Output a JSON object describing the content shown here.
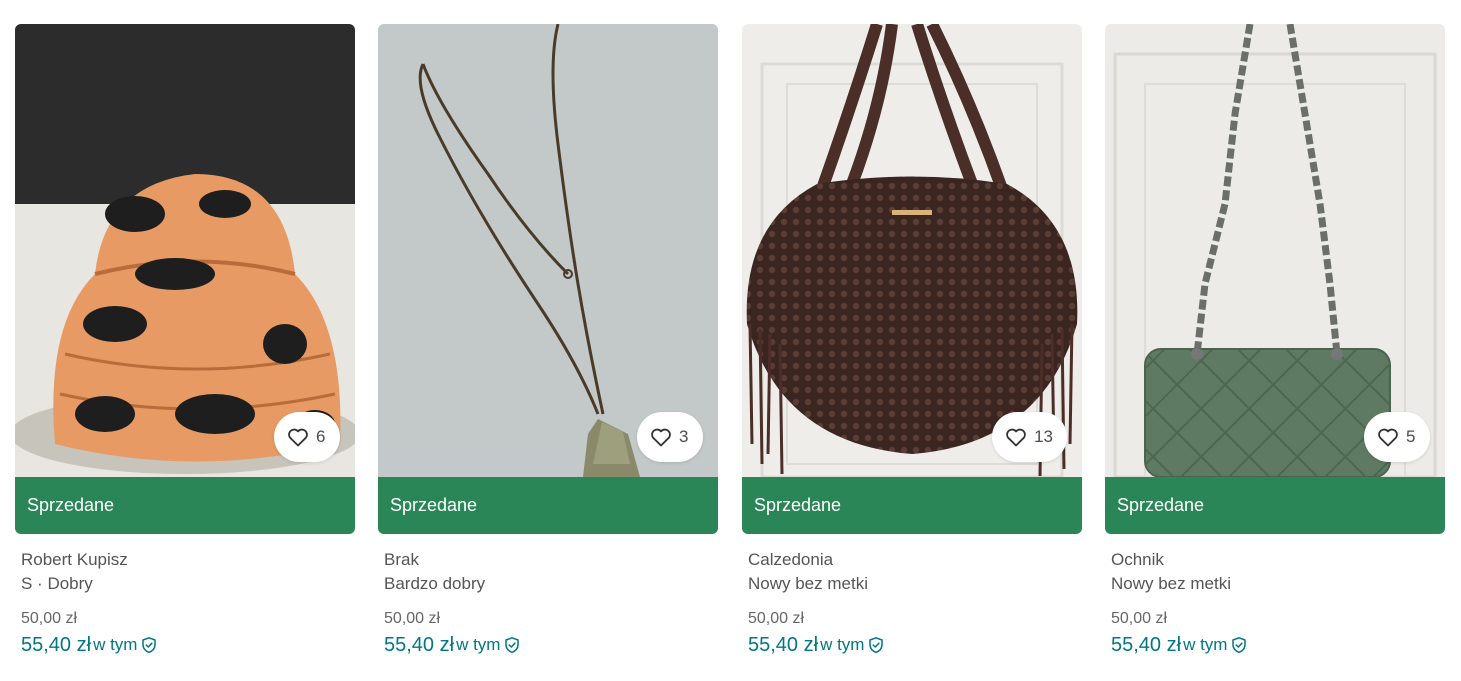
{
  "items": [
    {
      "image": "bucket-hat-photo",
      "likes": "6",
      "status": "Sprzedane",
      "brand": "Robert Kupisz",
      "details": "S · Dobry",
      "price": "50,00 zł",
      "total_price": "55,40 zł",
      "included_label": "w tym",
      "protection_icon": "shield-check-icon",
      "favourite_icon": "heart-icon"
    },
    {
      "image": "necklace-photo",
      "likes": "3",
      "status": "Sprzedane",
      "brand": "Brak",
      "details": "Bardzo dobry",
      "price": "50,00 zł",
      "total_price": "55,40 zł",
      "included_label": "w tym",
      "protection_icon": "shield-check-icon",
      "favourite_icon": "heart-icon"
    },
    {
      "image": "macrame-bag-photo",
      "likes": "13",
      "status": "Sprzedane",
      "brand": "Calzedonia",
      "details": "Nowy bez metki",
      "price": "50,00 zł",
      "total_price": "55,40 zł",
      "included_label": "w tym",
      "protection_icon": "shield-check-icon",
      "favourite_icon": "heart-icon"
    },
    {
      "image": "quilted-bag-photo",
      "likes": "5",
      "status": "Sprzedane",
      "brand": "Ochnik",
      "details": "Nowy bez metki",
      "price": "50,00 zł",
      "total_price": "55,40 zł",
      "included_label": "w tym",
      "protection_icon": "shield-check-icon",
      "favourite_icon": "heart-icon"
    }
  ],
  "colors": {
    "sold_bar": "#2a8657",
    "price_accent": "#007782",
    "text_secondary": "#555555"
  }
}
